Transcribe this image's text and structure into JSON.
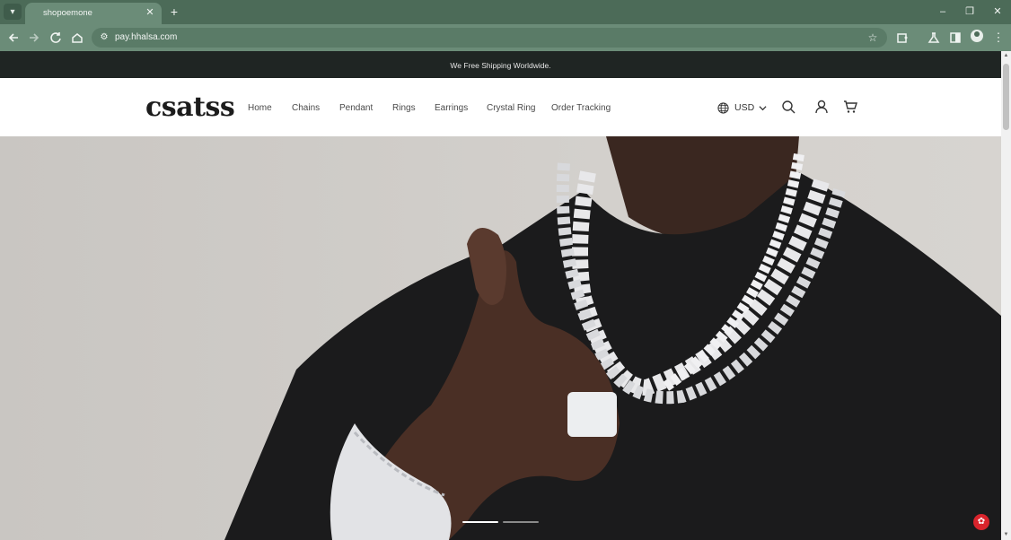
{
  "browser": {
    "tab_title": "shopoemone",
    "url": "pay.hhalsa.com",
    "icons": {
      "tab_list": "chevron-down-icon",
      "close_tab": "close-icon",
      "new_tab": "plus-icon",
      "back": "arrow-left-icon",
      "forward": "arrow-right-icon",
      "reload": "reload-icon",
      "home": "home-icon",
      "site_info": "tune-icon",
      "bookmark": "star-icon",
      "extensions": "puzzle-icon",
      "labs": "flask-icon",
      "side_panel": "side-panel-icon",
      "profile": "profile-icon",
      "menu": "kebab-menu-icon",
      "minimize": "minimize-icon",
      "restore": "restore-icon",
      "close_window": "close-icon"
    },
    "colors": {
      "frame": "#4c6b58",
      "toolbar": "#6b8c78"
    }
  },
  "announcement": {
    "text": "We Free Shipping Worldwide."
  },
  "header": {
    "logo": "csatss",
    "nav": [
      {
        "label": "Home"
      },
      {
        "label": "Chains"
      },
      {
        "label": "Pendant"
      },
      {
        "label": "Rings"
      },
      {
        "label": "Earrings"
      },
      {
        "label": "Crystal Ring"
      },
      {
        "label": "Order Tracking"
      }
    ],
    "currency": "USD",
    "icons": {
      "currency": "globe-icon",
      "search": "search-icon",
      "account": "user-icon",
      "cart": "cart-icon"
    }
  },
  "hero": {
    "image": "man-wearing-iced-chains-photo",
    "slides_total": 2,
    "active_slide": 1
  },
  "chat_widget": {
    "icon": "chat-icon",
    "color": "#d9242c"
  }
}
